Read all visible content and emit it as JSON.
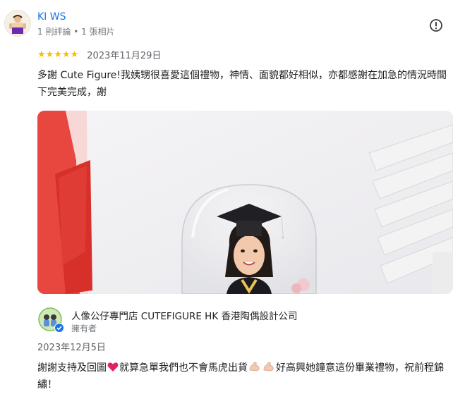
{
  "review": {
    "reviewer_name": "KI WS",
    "reviewer_meta": "1 則評論 • 1 張相片",
    "rating": 5,
    "stars": [
      "★",
      "★",
      "★",
      "★",
      "★"
    ],
    "date": "2023年11月29日",
    "text": "多謝 Cute Figure!我姨甥很喜愛這個禮物，神情、面貌都好相似，亦都感謝在加急的情況時間下完美完成，謝",
    "report_icon": "alert-circle-icon",
    "star_color": "#fbbc04",
    "link_color": "#1a73e8"
  },
  "owner_response": {
    "name": "人像公仔專門店 CUTEFIGURE HK 香港陶偶設計公司",
    "role": "擁有者",
    "date": "2023年12月5日",
    "reply_part1": "謝謝支持及回圖",
    "reply_part2": "就算急單我們也不會馬虎出貨",
    "reply_part3": "好高興她鐘意這份畢業禮物，祝前程錦繡！",
    "verified_icon": "verified-check-icon"
  }
}
